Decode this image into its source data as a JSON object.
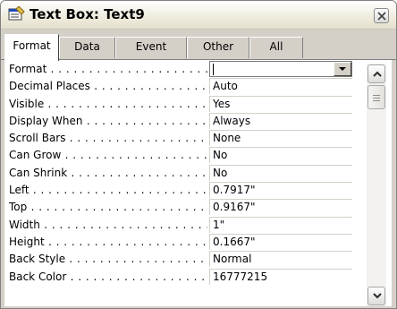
{
  "window": {
    "title": "Text Box: Text9",
    "icon": "properties-sheet-icon",
    "close_icon": "close-icon"
  },
  "tabs": [
    {
      "label": "Format",
      "active": true
    },
    {
      "label": "Data",
      "active": false
    },
    {
      "label": "Event",
      "active": false
    },
    {
      "label": "Other",
      "active": false
    },
    {
      "label": "All",
      "active": false
    }
  ],
  "properties": [
    {
      "name": "Format",
      "value": ""
    },
    {
      "name": "Decimal Places",
      "value": "Auto"
    },
    {
      "name": "Visible",
      "value": "Yes"
    },
    {
      "name": "Display When",
      "value": "Always"
    },
    {
      "name": "Scroll Bars",
      "value": "None"
    },
    {
      "name": "Can Grow",
      "value": "No"
    },
    {
      "name": "Can Shrink",
      "value": "No"
    },
    {
      "name": "Left",
      "value": "0.7917\""
    },
    {
      "name": "Top",
      "value": "0.9167\""
    },
    {
      "name": "Width",
      "value": "1\""
    },
    {
      "name": "Height",
      "value": "0.1667\""
    },
    {
      "name": "Back Style",
      "value": "Normal"
    },
    {
      "name": "Back Color",
      "value": "16777215"
    }
  ],
  "colors": {
    "window_face": "#d4d0c8",
    "panel_bg": "#ffffff"
  }
}
